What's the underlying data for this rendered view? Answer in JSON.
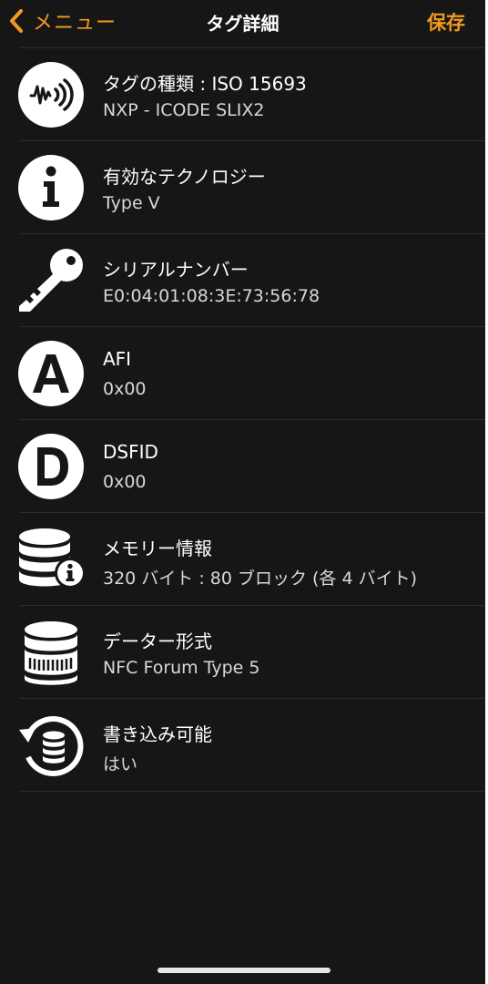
{
  "colors": {
    "background": "#161616",
    "accent": "#f29a1f",
    "text": "#ffffff",
    "subtext": "#d8d8d8",
    "divider": "#2c2c2c"
  },
  "navbar": {
    "back_label": "メニュー",
    "back_icon": "chevron-left-icon",
    "title": "タグ詳細",
    "save_label": "保存"
  },
  "rows": [
    {
      "icon": "nfc-signal-icon",
      "title": "タグの種類 : ISO 15693",
      "value": "NXP - ICODE SLIX2"
    },
    {
      "icon": "info-icon",
      "title": "有効なテクノロジー",
      "value": "Type V"
    },
    {
      "icon": "key-icon",
      "title": "シリアルナンバー",
      "value": "E0:04:01:08:3E:73:56:78"
    },
    {
      "icon": "letter-a-icon",
      "title": "AFI",
      "value": "0x00"
    },
    {
      "icon": "letter-d-icon",
      "title": "DSFID",
      "value": "0x00"
    },
    {
      "icon": "database-info-icon",
      "title": "メモリー情報",
      "value": "320 バイト : 80 ブロック (各 4 バイト)"
    },
    {
      "icon": "database-format-icon",
      "title": "データー形式",
      "value": "NFC Forum Type 5"
    },
    {
      "icon": "database-rewrite-icon",
      "title": "書き込み可能",
      "value": "はい"
    }
  ]
}
